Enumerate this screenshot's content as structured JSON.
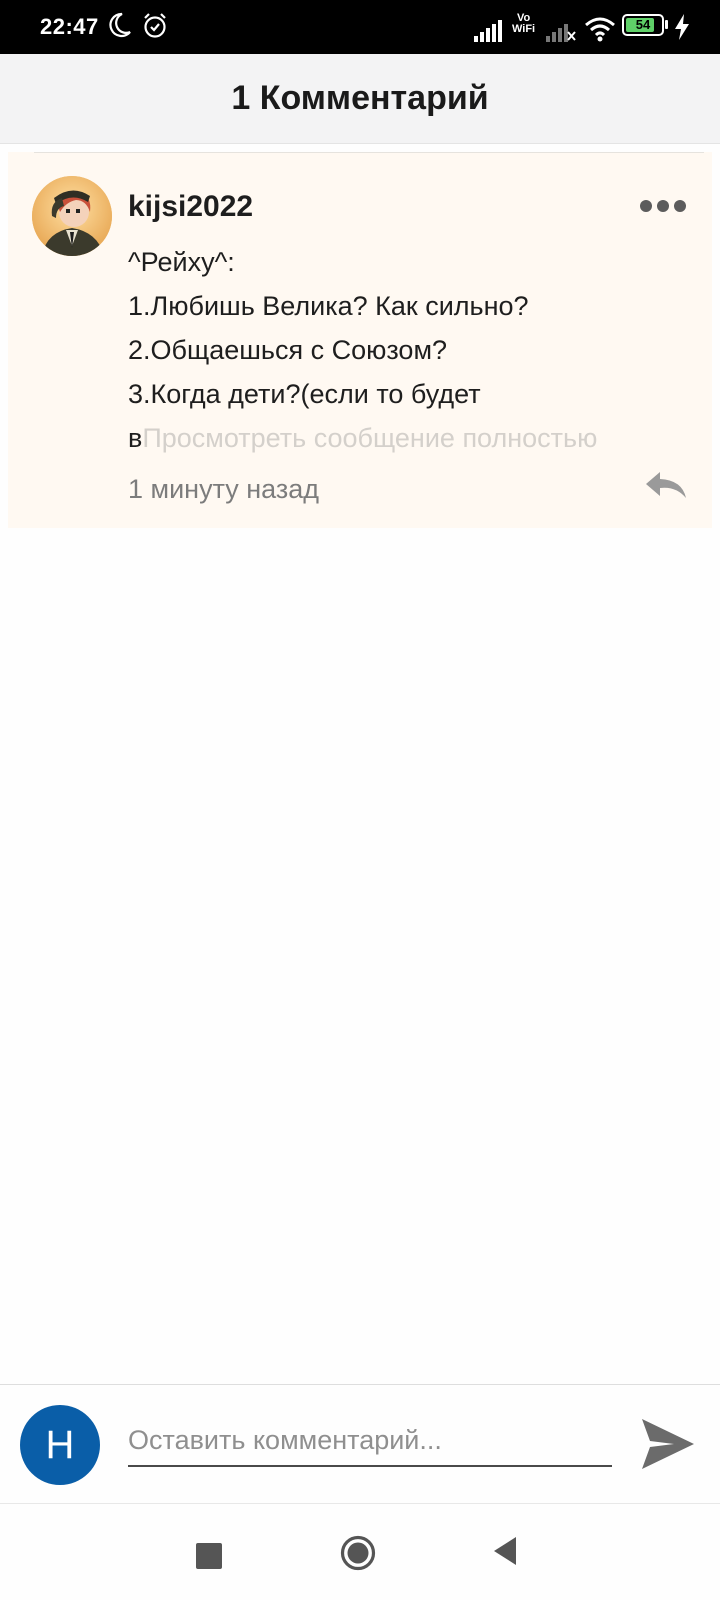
{
  "status_bar": {
    "time": "22:47",
    "battery": "54",
    "vowifi_top": "Vo",
    "vowifi_bottom": "WiFi"
  },
  "header": {
    "title": "1 Комментарий"
  },
  "comment": {
    "username": "kijsi2022",
    "lines": [
      "^Рейху^:",
      "1.Любишь Велика? Как сильно?",
      "2.Общаешься с Союзом?",
      "3.Когда дети?(если то будет"
    ],
    "last_line_start": "в",
    "view_full_label": "Просмотреть сообщение полностью",
    "timestamp": "1 минуту назад"
  },
  "input": {
    "avatar_letter": "Н",
    "placeholder": "Оставить комментарий..."
  },
  "colors": {
    "card_background": "#fff9f2",
    "user_avatar": "#0a5ea8",
    "header_background": "#f3f3f4"
  }
}
